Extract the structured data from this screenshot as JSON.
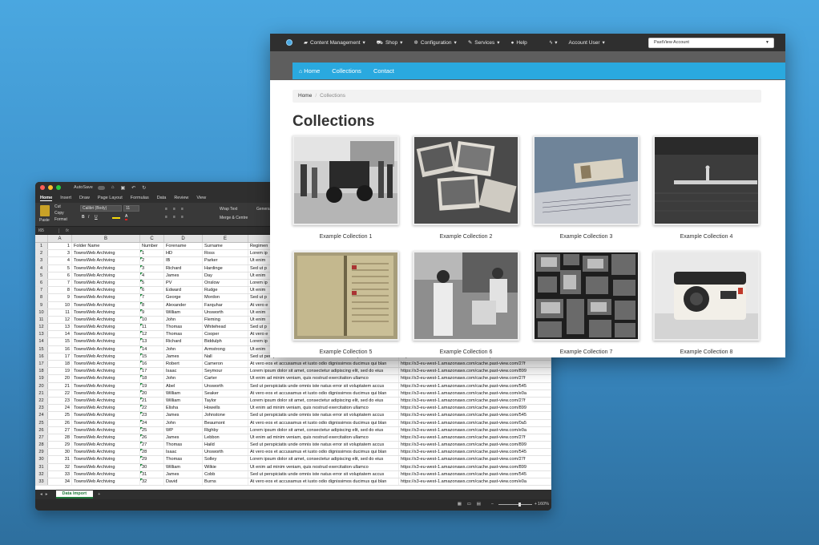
{
  "excel": {
    "autosave_label": "AutoSave",
    "ribbon_tabs": [
      "Home",
      "Insert",
      "Draw",
      "Page Layout",
      "Formulas",
      "Data",
      "Review",
      "View"
    ],
    "clipboard": {
      "paste": "Paste",
      "cut": "Cut",
      "copy": "Copy",
      "format": "Format"
    },
    "font_name": "Calibri (Body)",
    "font_size": "11",
    "wrap_text": "Wrap Text",
    "merge_centre": "Merge & Centre",
    "number_format_partial": "Genera",
    "name_box": "I65",
    "fx_label": "fx",
    "column_headers": [
      "A",
      "B",
      "C",
      "D",
      "E",
      "F"
    ],
    "header_row": [
      "1",
      "Folder Name",
      "Number",
      "Forename",
      "Surname",
      "Regimen"
    ],
    "rows": [
      [
        "2",
        "3",
        "TownsWeb Archiving",
        "1",
        "HD",
        "Ross",
        "Lorem ip",
        ""
      ],
      [
        "3",
        "4",
        "TownsWeb Archiving",
        "2",
        "IB",
        "Parker",
        "Ut enim",
        ""
      ],
      [
        "4",
        "5",
        "TownsWeb Archiving",
        "3",
        "Richard",
        "Hardinge",
        "Sed ut p",
        ""
      ],
      [
        "5",
        "6",
        "TownsWeb Archiving",
        "4",
        "James",
        "Day",
        "Ut enim",
        ""
      ],
      [
        "6",
        "7",
        "TownsWeb Archiving",
        "5",
        "PV",
        "Onslow",
        "Lorem ip",
        ""
      ],
      [
        "7",
        "8",
        "TownsWeb Archiving",
        "6",
        "Edward",
        "Rudge",
        "Ut enim",
        ""
      ],
      [
        "8",
        "9",
        "TownsWeb Archiving",
        "7",
        "George",
        "Mordon",
        "Sed ut p",
        ""
      ],
      [
        "9",
        "10",
        "TownsWeb Archiving",
        "8",
        "Alexander",
        "Farquhar",
        "At vero e",
        ""
      ],
      [
        "10",
        "11",
        "TownsWeb Archiving",
        "9",
        "William",
        "Unsworth",
        "Ut enim",
        ""
      ],
      [
        "11",
        "12",
        "TownsWeb Archiving",
        "10",
        "John",
        "Fleming",
        "Ut enim",
        ""
      ],
      [
        "12",
        "13",
        "TownsWeb Archiving",
        "11",
        "Thomas",
        "Whitehead",
        "Sed ut p",
        ""
      ],
      [
        "13",
        "14",
        "TownsWeb Archiving",
        "12",
        "Thomas",
        "Cooper",
        "At vero e",
        ""
      ],
      [
        "14",
        "15",
        "TownsWeb Archiving",
        "13",
        "Richard",
        "Biddulph",
        "Lorem ip",
        ""
      ],
      [
        "15",
        "16",
        "TownsWeb Archiving",
        "14",
        "John",
        "Armstrong",
        "Ut enim",
        ""
      ],
      [
        "16",
        "17",
        "TownsWeb Archiving",
        "15",
        "James",
        "Nall",
        "Sed ut perspiciatis unde omnis iste natus error sit voluptatem accus",
        "https://s3-eu-west-1.amazonaws.com/cache.past-view.com/e0a"
      ],
      [
        "17",
        "18",
        "TownsWeb Archiving",
        "16",
        "Robert",
        "Cameron",
        "At vero eos et accusamus et iusto odio dignissimos ducimus qui blan",
        "https://s3-eu-west-1.amazonaws.com/cache.past-view.com/27f"
      ],
      [
        "18",
        "19",
        "TownsWeb Archiving",
        "17",
        "Isaac",
        "Seymour",
        "Lorem ipsum dolor sit amet, consectetur adipiscing elit, sed do eius",
        "https://s3-eu-west-1.amazonaws.com/cache.past-view.com/899"
      ],
      [
        "19",
        "20",
        "TownsWeb Archiving",
        "18",
        "John",
        "Carter",
        "Ut enim ad minim veniam, quis nostrud exercitation ullamco",
        "https://s3-eu-west-1.amazonaws.com/cache.past-view.com/27f"
      ],
      [
        "20",
        "21",
        "TownsWeb Archiving",
        "19",
        "Abel",
        "Unsworth",
        "Sed ut perspiciatis unde omnis iste natus error sit voluptatem accus",
        "https://s3-eu-west-1.amazonaws.com/cache.past-view.com/545"
      ],
      [
        "21",
        "22",
        "TownsWeb Archiving",
        "20",
        "William",
        "Seaker",
        "At vero eos et accusamus et iusto odio dignissimos ducimus qui blan",
        "https://s3-eu-west-1.amazonaws.com/cache.past-view.com/e0a"
      ],
      [
        "22",
        "23",
        "TownsWeb Archiving",
        "21",
        "William",
        "Taylor",
        "Lorem ipsum dolor sit amet, consectetur adipiscing elit, sed do eius",
        "https://s3-eu-west-1.amazonaws.com/cache.past-view.com/27f"
      ],
      [
        "23",
        "24",
        "TownsWeb Archiving",
        "22",
        "Elisha",
        "Howells",
        "Ut enim ad minim veniam, quis nostrud exercitation ullamco",
        "https://s3-eu-west-1.amazonaws.com/cache.past-view.com/899"
      ],
      [
        "24",
        "25",
        "TownsWeb Archiving",
        "23",
        "James",
        "Johnstone",
        "Sed ut perspiciatis unde omnis iste natus error sit voluptatem accus",
        "https://s3-eu-west-1.amazonaws.com/cache.past-view.com/545"
      ],
      [
        "25",
        "26",
        "TownsWeb Archiving",
        "24",
        "John",
        "Beaumont",
        "At vero eos et accusamus et iusto odio dignissimos ducimus qui blan",
        "https://s3-eu-west-1.amazonaws.com/cache.past-view.com/0a5"
      ],
      [
        "26",
        "27",
        "TownsWeb Archiving",
        "25",
        "WP",
        "Righby",
        "Lorem ipsum dolor sit amet, consectetur adipiscing elit, sed do eius",
        "https://s3-eu-west-1.amazonaws.com/cache.past-view.com/e0a"
      ],
      [
        "27",
        "28",
        "TownsWeb Archiving",
        "26",
        "James",
        "Lebbon",
        "Ut enim ad minim veniam, quis nostrud exercitation ullamco",
        "https://s3-eu-west-1.amazonaws.com/cache.past-view.com/27f"
      ],
      [
        "28",
        "29",
        "TownsWeb Archiving",
        "27",
        "Thomas",
        "Haild",
        "Sed ut perspiciatis unde omnis iste natus error sit voluptatem accus",
        "https://s3-eu-west-1.amazonaws.com/cache.past-view.com/899"
      ],
      [
        "29",
        "30",
        "TownsWeb Archiving",
        "28",
        "Isaac",
        "Unsworth",
        "At vero eos et accusamus et iusto odio dignissimos ducimus qui blan",
        "https://s3-eu-west-1.amazonaws.com/cache.past-view.com/545"
      ],
      [
        "30",
        "31",
        "TownsWeb Archiving",
        "29",
        "Thomas",
        "Solley",
        "Lorem ipsum dolor sit amet, consectetur adipiscing elit, sed do eius",
        "https://s3-eu-west-1.amazonaws.com/cache.past-view.com/27f"
      ],
      [
        "31",
        "32",
        "TownsWeb Archiving",
        "30",
        "William",
        "Wilkie",
        "Ut enim ad minim veniam, quis nostrud exercitation ullamco",
        "https://s3-eu-west-1.amazonaws.com/cache.past-view.com/899"
      ],
      [
        "32",
        "33",
        "TownsWeb Archiving",
        "31",
        "James",
        "Cobb",
        "Sed ut perspiciatis unde omnis iste natus error sit voluptatem accus",
        "https://s3-eu-west-1.amazonaws.com/cache.past-view.com/545"
      ],
      [
        "33",
        "34",
        "TownsWeb Archiving",
        "32",
        "David",
        "Burns",
        "At vero eos et accusamus et iusto odio dignissimos ducimus qui blan",
        "https://s3-eu-west-1.amazonaws.com/cache.past-view.com/e0a"
      ]
    ],
    "sheet_tab": "Data Import",
    "zoom_level": "160%",
    "zoom_fraction": 0.62
  },
  "browser": {
    "top_nav": [
      "Content Management",
      "Shop",
      "Configuration",
      "Services",
      "Help"
    ],
    "account_menu": "Account User",
    "account_select": "PastView Account",
    "site_nav": [
      "Home",
      "Collections",
      "Contact"
    ],
    "breadcrumb": {
      "home": "Home",
      "current": "Collections"
    },
    "page_title": "Collections",
    "collections": [
      "Example Collection 1",
      "Example Collection 2",
      "Example Collection 3",
      "Example Collection 4",
      "Example Collection 5",
      "Example Collection 6",
      "Example Collection 7",
      "Example Collection 8"
    ]
  },
  "colors": {
    "background": "#4aa7e0",
    "site_nav_blue": "#2aa9df",
    "dark_nav": "#2f2f2f",
    "excel_green": "#1f7a3a"
  }
}
